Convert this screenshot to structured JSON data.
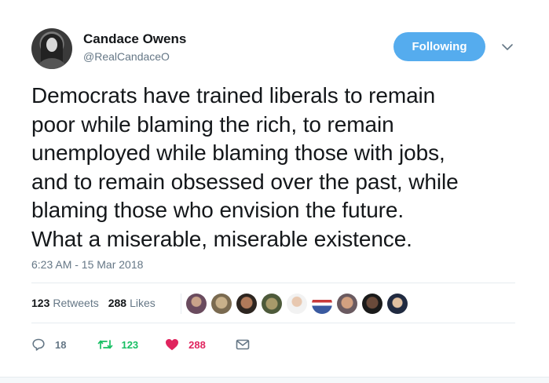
{
  "author": {
    "name": "Candace Owens",
    "handle": "@RealCandaceO"
  },
  "follow_button": {
    "label": "Following"
  },
  "tweet": {
    "lines": [
      "Democrats have trained liberals to remain",
      "poor while blaming the rich, to remain",
      "unemployed while blaming those with jobs,",
      "and to remain obsessed over the past, while",
      "blaming those who envision the future.",
      "What a miserable, miserable existence."
    ],
    "timestamp": "6:23 AM - 15 Mar 2018"
  },
  "stats": {
    "retweets_count": "123",
    "retweets_label": "Retweets",
    "likes_count": "288",
    "likes_label": "Likes"
  },
  "actions": {
    "reply_count": "18",
    "retweet_count": "123",
    "like_count": "288"
  },
  "colors": {
    "accent": "#55acee",
    "retweet": "#17bf63",
    "like": "#e0245e",
    "muted": "#657786"
  },
  "icons": {
    "reply": "reply-icon",
    "retweet": "retweet-icon",
    "like": "heart-icon",
    "dm": "envelope-icon",
    "caret": "chevron-down-icon"
  }
}
